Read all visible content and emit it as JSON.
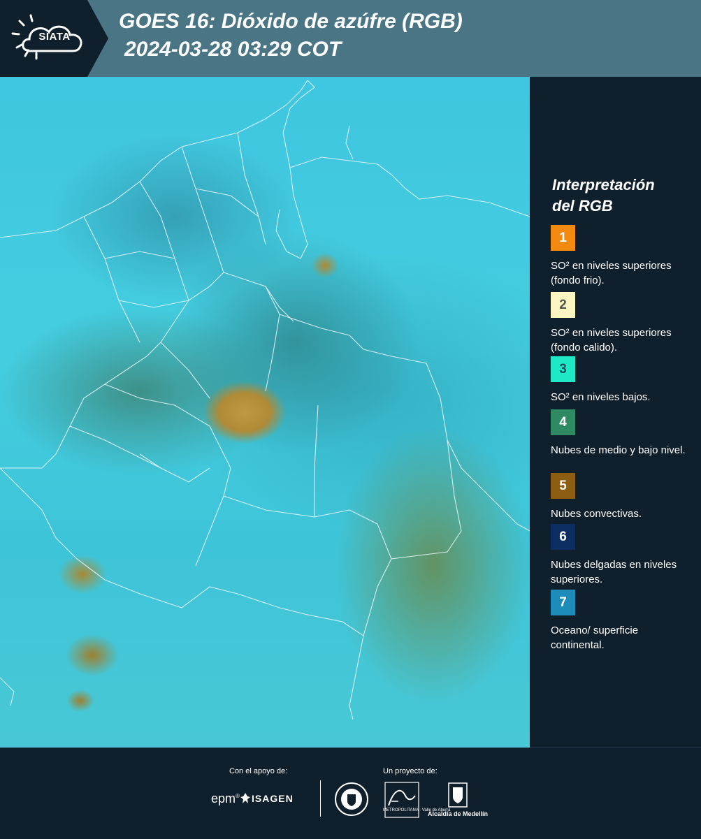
{
  "header": {
    "logo_text": "SIATA",
    "title": "GOES 16: Dióxido de azúfre (RGB)",
    "timestamp": "2024-03-28 03:29 COT"
  },
  "legend": {
    "title_line1": "Interpretación",
    "title_line2": "del RGB",
    "items": [
      {
        "number": "1",
        "color": "#f28a10",
        "text_color": "#ffffff",
        "label": "SO² en niveles superiores (fondo frio)."
      },
      {
        "number": "2",
        "color": "#fdf5c2",
        "text_color": "#555555",
        "label": "SO² en niveles superiores (fondo calido)."
      },
      {
        "number": "3",
        "color": "#1fe8c6",
        "text_color": "#1a4d5c",
        "label": "SO² en niveles bajos."
      },
      {
        "number": "4",
        "color": "#2e8a62",
        "text_color": "#ffffff",
        "label": "Nubes de medio y bajo nivel."
      },
      {
        "number": "5",
        "color": "#8d5e12",
        "text_color": "#ffffff",
        "label": "Nubes convectivas."
      },
      {
        "number": "6",
        "color": "#0d2e62",
        "text_color": "#ffffff",
        "label": "Nubes delgadas en niveles superiores."
      },
      {
        "number": "7",
        "color": "#1e8cb8",
        "text_color": "#ffffff",
        "label": "Oceano/ superficie continental."
      }
    ]
  },
  "footer": {
    "support_label": "Con el apoyo de:",
    "project_label": "Un proyecto de:",
    "sponsor_epm": "epm",
    "sponsor_isagen": "ISAGEN",
    "area_subtitle": "METROPOLITANA · Valle de Aburrá",
    "alcaldia": "Alcaldía de Medellín"
  }
}
